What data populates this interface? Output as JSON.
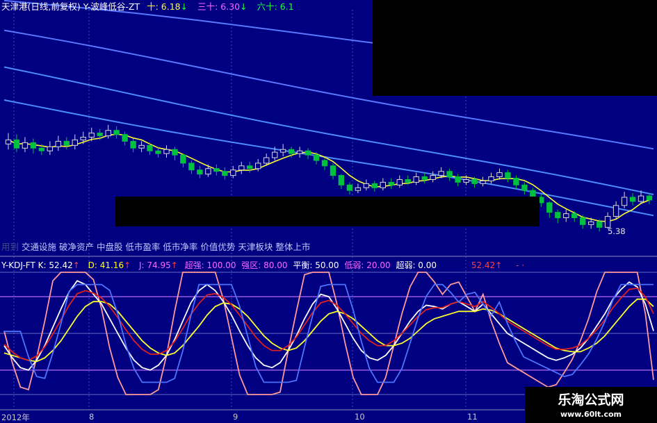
{
  "header": {
    "stock": "天津港(日线,前复权)",
    "indicator": "Y-波峰低谷-ZT",
    "ma": [
      {
        "label": "十: 6.18",
        "arrow": "↓"
      },
      {
        "label": "三十: 6.30",
        "arrow": "↓"
      },
      {
        "label": "六十: 6.1"
      }
    ]
  },
  "tags": {
    "prefix": "用到",
    "items": "交通设施 破净资产 中盘股 低市盈率 低市净率 价值优势 天津板块 整体上市"
  },
  "kdj_header": {
    "name": "Y-KDJ-FT",
    "k": "K: 52.42",
    "d": "D: 41.16",
    "j": "J: 74.95",
    "chaoqiang": "超强: 100.00",
    "qiangqu": "强区: 80.00",
    "pingheng": "平衡: 50.00",
    "diruo": "低弱: 20.00",
    "chaoruo": "超弱: 0.00",
    "k_repeat": "52.42",
    "tail": "- ·"
  },
  "price_label": "5.38",
  "dates": [
    "2012年",
    "8",
    "9",
    "10",
    "11"
  ],
  "watermark": {
    "name": "乐淘公式网",
    "url": "www.60lt.com"
  },
  "colors": {
    "bg": "#000080",
    "grid": "#3a4fc8",
    "up": "#d9d9d9",
    "down": "#00c040",
    "k": "#ffffff",
    "d": "#ffff30",
    "j": "#ff9a9a",
    "mid": "#e02020",
    "blue": "#4d74ff",
    "level": "#8d52d8"
  },
  "chart_data": [
    {
      "type": "candlestick",
      "title": "天津港(日线,前复权)",
      "price_range_visible": [
        5.3,
        6.2
      ],
      "moving_averages": {
        "十": 6.18,
        "三十": 6.3,
        "六十": 6.1
      },
      "candles": [
        [
          6.0,
          6.03,
          6.08,
          5.96
        ],
        [
          6.03,
          5.97,
          6.07,
          5.94
        ],
        [
          5.97,
          6.01,
          6.05,
          5.94
        ],
        [
          6.01,
          5.97,
          6.04,
          5.93
        ],
        [
          5.97,
          5.95,
          6.0,
          5.92
        ],
        [
          5.95,
          5.98,
          6.02,
          5.92
        ],
        [
          5.98,
          6.02,
          6.06,
          5.95
        ],
        [
          6.02,
          5.99,
          6.05,
          5.96
        ],
        [
          5.99,
          6.03,
          6.07,
          5.96
        ],
        [
          6.03,
          6.05,
          6.09,
          6.0
        ],
        [
          6.05,
          6.08,
          6.12,
          6.02
        ],
        [
          6.08,
          6.06,
          6.11,
          6.03
        ],
        [
          6.06,
          6.1,
          6.14,
          6.04
        ],
        [
          6.1,
          6.07,
          6.13,
          6.04
        ],
        [
          6.07,
          6.02,
          6.09,
          5.99
        ],
        [
          6.02,
          5.97,
          6.04,
          5.94
        ],
        [
          5.97,
          5.99,
          6.02,
          5.94
        ],
        [
          5.99,
          5.95,
          6.01,
          5.92
        ],
        [
          5.95,
          5.93,
          5.98,
          5.9
        ],
        [
          5.93,
          5.96,
          5.99,
          5.9
        ],
        [
          5.96,
          5.92,
          5.98,
          5.88
        ],
        [
          5.92,
          5.86,
          5.93,
          5.83
        ],
        [
          5.86,
          5.81,
          5.88,
          5.78
        ],
        [
          5.81,
          5.78,
          5.84,
          5.75
        ],
        [
          5.78,
          5.82,
          5.85,
          5.76
        ],
        [
          5.82,
          5.8,
          5.85,
          5.77
        ],
        [
          5.8,
          5.77,
          5.83,
          5.74
        ],
        [
          5.77,
          5.81,
          5.84,
          5.75
        ],
        [
          5.81,
          5.84,
          5.87,
          5.78
        ],
        [
          5.84,
          5.82,
          5.87,
          5.79
        ],
        [
          5.82,
          5.86,
          5.89,
          5.8
        ],
        [
          5.86,
          5.9,
          5.93,
          5.84
        ],
        [
          5.9,
          5.94,
          5.98,
          5.88
        ],
        [
          5.94,
          5.96,
          6.0,
          5.91
        ],
        [
          5.96,
          5.93,
          5.98,
          5.9
        ],
        [
          5.93,
          5.95,
          5.98,
          5.9
        ],
        [
          5.95,
          5.92,
          5.97,
          5.89
        ],
        [
          5.92,
          5.88,
          5.94,
          5.85
        ],
        [
          5.88,
          5.84,
          5.9,
          5.81
        ],
        [
          5.84,
          5.77,
          5.86,
          5.74
        ],
        [
          5.77,
          5.7,
          5.78,
          5.67
        ],
        [
          5.7,
          5.66,
          5.72,
          5.63
        ],
        [
          5.66,
          5.68,
          5.71,
          5.64
        ],
        [
          5.68,
          5.71,
          5.74,
          5.66
        ],
        [
          5.71,
          5.68,
          5.73,
          5.65
        ],
        [
          5.68,
          5.72,
          5.75,
          5.66
        ],
        [
          5.72,
          5.7,
          5.75,
          5.67
        ],
        [
          5.7,
          5.74,
          5.77,
          5.68
        ],
        [
          5.74,
          5.72,
          5.77,
          5.7
        ],
        [
          5.72,
          5.76,
          5.79,
          5.7
        ],
        [
          5.76,
          5.74,
          5.79,
          5.71
        ],
        [
          5.74,
          5.77,
          5.8,
          5.72
        ],
        [
          5.77,
          5.8,
          5.83,
          5.75
        ],
        [
          5.8,
          5.76,
          5.82,
          5.73
        ],
        [
          5.76,
          5.72,
          5.78,
          5.69
        ],
        [
          5.72,
          5.74,
          5.77,
          5.7
        ],
        [
          5.74,
          5.71,
          5.76,
          5.68
        ],
        [
          5.71,
          5.73,
          5.76,
          5.69
        ],
        [
          5.73,
          5.76,
          5.79,
          5.71
        ],
        [
          5.76,
          5.79,
          5.82,
          5.74
        ],
        [
          5.79,
          5.75,
          5.81,
          5.72
        ],
        [
          5.75,
          5.7,
          5.77,
          5.67
        ],
        [
          5.7,
          5.66,
          5.72,
          5.63
        ],
        [
          5.66,
          5.61,
          5.68,
          5.58
        ],
        [
          5.61,
          5.57,
          5.63,
          5.54
        ],
        [
          5.57,
          5.5,
          5.58,
          5.46
        ],
        [
          5.5,
          5.46,
          5.52,
          5.42
        ],
        [
          5.46,
          5.49,
          5.52,
          5.43
        ],
        [
          5.49,
          5.46,
          5.51,
          5.43
        ],
        [
          5.46,
          5.41,
          5.48,
          5.38
        ],
        [
          5.41,
          5.43,
          5.46,
          5.38
        ],
        [
          5.43,
          5.39,
          5.45,
          5.36
        ],
        [
          5.39,
          5.47,
          5.5,
          5.38
        ],
        [
          5.47,
          5.55,
          5.58,
          5.45
        ],
        [
          5.55,
          5.61,
          5.65,
          5.53
        ],
        [
          5.61,
          5.58,
          5.64,
          5.55
        ],
        [
          5.58,
          5.62,
          5.66,
          5.56
        ],
        [
          5.62,
          5.59,
          5.64,
          5.56
        ]
      ]
    },
    {
      "type": "line",
      "title": "Y-KDJ-FT",
      "ylim": [
        0,
        100
      ],
      "levels": [
        100,
        80,
        50,
        20,
        0
      ],
      "series": [
        {
          "name": "K",
          "values": [
            40,
            30,
            22,
            20,
            28,
            40,
            55,
            70,
            84,
            93,
            90,
            82,
            74,
            62,
            50,
            38,
            28,
            22,
            20,
            24,
            32,
            45,
            60,
            75,
            85,
            90,
            85,
            76,
            65,
            52,
            40,
            30,
            24,
            22,
            26,
            36,
            48,
            62,
            74,
            82,
            80,
            70,
            58,
            46,
            36,
            30,
            28,
            32,
            40,
            50,
            60,
            68,
            73,
            72,
            70,
            74,
            76,
            72,
            68,
            74,
            66,
            58,
            50,
            46,
            42,
            38,
            34,
            30,
            28,
            30,
            33,
            38,
            46,
            56,
            66,
            78,
            86,
            92,
            88,
            74,
            52
          ]
        },
        {
          "name": "D",
          "values": [
            34,
            32,
            30,
            28,
            27,
            30,
            36,
            44,
            54,
            64,
            72,
            76,
            76,
            74,
            68,
            60,
            52,
            44,
            38,
            34,
            32,
            34,
            40,
            48,
            56,
            65,
            72,
            75,
            74,
            70,
            64,
            56,
            48,
            42,
            38,
            36,
            38,
            44,
            52,
            60,
            66,
            68,
            66,
            62,
            56,
            50,
            44,
            40,
            40,
            42,
            46,
            52,
            58,
            62,
            64,
            66,
            68,
            68,
            68,
            70,
            69,
            66,
            62,
            58,
            54,
            50,
            46,
            42,
            38,
            36,
            35,
            35,
            38,
            42,
            48,
            56,
            64,
            72,
            78,
            78,
            72
          ]
        },
        {
          "name": "J",
          "values": [
            52,
            26,
            6,
            4,
            30,
            60,
            93,
            100,
            100,
            100,
            100,
            94,
            70,
            38,
            14,
            0,
            0,
            0,
            0,
            4,
            32,
            68,
            100,
            100,
            100,
            100,
            100,
            78,
            47,
            16,
            0,
            0,
            0,
            0,
            2,
            36,
            68,
            98,
            100,
            100,
            100,
            74,
            42,
            14,
            0,
            0,
            0,
            14,
            40,
            66,
            88,
            100,
            100,
            92,
            82,
            90,
            92,
            80,
            68,
            82,
            60,
            42,
            26,
            22,
            18,
            14,
            10,
            6,
            8,
            18,
            29,
            44,
            62,
            84,
            100,
            100,
            100,
            100,
            100,
            66,
            12
          ]
        }
      ]
    }
  ]
}
